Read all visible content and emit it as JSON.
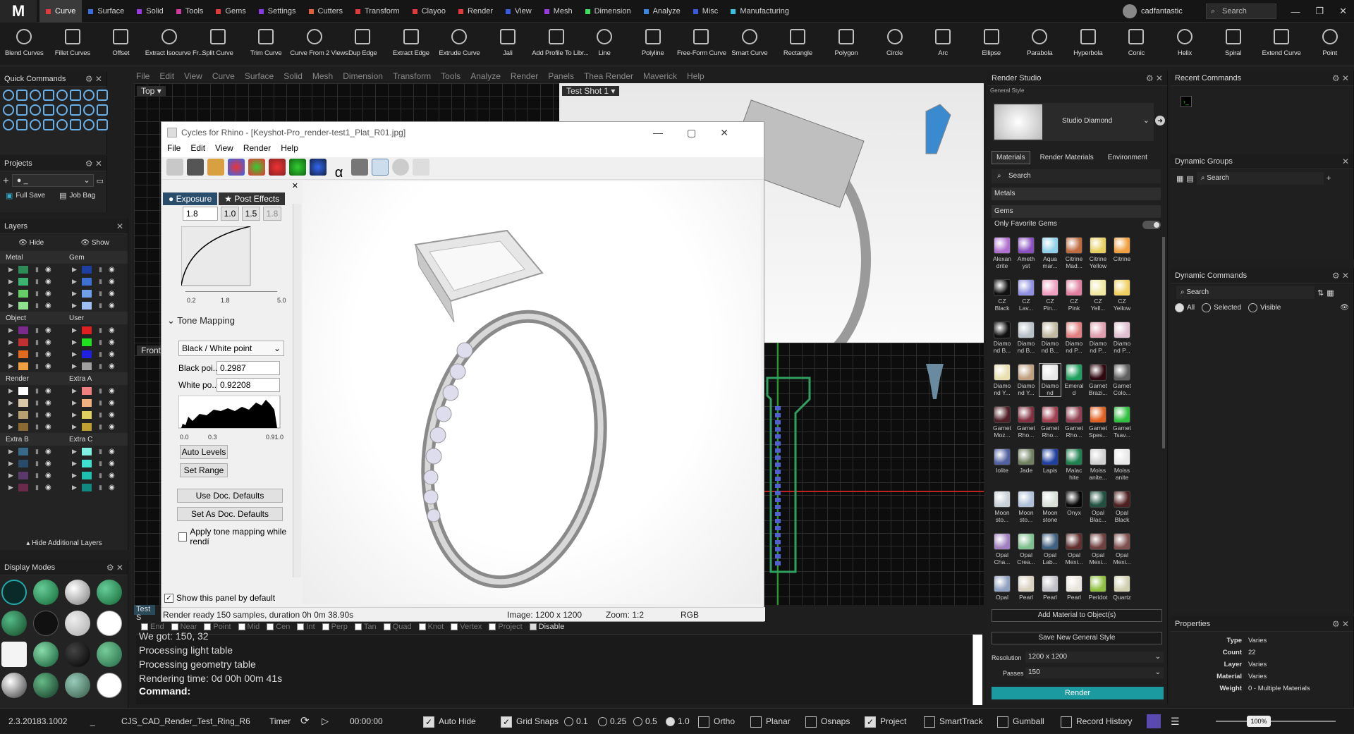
{
  "app": {
    "logo": "M",
    "user": "cadfantastic",
    "search": "Search"
  },
  "tabs": [
    {
      "label": "Curve",
      "color": "#e03a3a"
    },
    {
      "label": "Surface",
      "color": "#3a6ee0"
    },
    {
      "label": "Solid",
      "color": "#9a3ae0"
    },
    {
      "label": "Tools",
      "color": "#d03aa0"
    },
    {
      "label": "Gems",
      "color": "#e03a3a"
    },
    {
      "label": "Settings",
      "color": "#8a3ae0"
    },
    {
      "label": "Cutters",
      "color": "#e0603a"
    },
    {
      "label": "Transform",
      "color": "#e03a3a"
    },
    {
      "label": "Clayoo",
      "color": "#e03a3a"
    },
    {
      "label": "Render",
      "color": "#e03a3a"
    },
    {
      "label": "View",
      "color": "#3a5ae0"
    },
    {
      "label": "Mesh",
      "color": "#9a3ae0"
    },
    {
      "label": "Dimension",
      "color": "#3ae05a"
    },
    {
      "label": "Analyze",
      "color": "#3a8ae0"
    },
    {
      "label": "Misc",
      "color": "#3a5ae0"
    },
    {
      "label": "Manufacturing",
      "color": "#3ac0e0"
    }
  ],
  "tools": [
    "Blend Curves",
    "Fillet Curves",
    "Offset",
    "Extract Isocurve Fr...",
    "Split Curve",
    "Trim Curve",
    "Curve From 2 Views",
    "Dup Edge",
    "Extract Edge",
    "Extrude Curve",
    "Jali",
    "Add Profile To Libr...",
    "Line",
    "Polyline",
    "Free-Form Curve",
    "Smart Curve",
    "Rectangle",
    "Polygon",
    "Circle",
    "Arc",
    "Ellipse",
    "Parabola",
    "Hyperbola",
    "Conic",
    "Helix",
    "Spiral",
    "Extend Curve",
    "Point"
  ],
  "quick_commands": {
    "title": "Quick Commands"
  },
  "projects": {
    "title": "Projects",
    "dropdown": "_",
    "full_save": "Full Save",
    "job_bag": "Job Bag"
  },
  "layers": {
    "title": "Layers",
    "hide": "Hide",
    "show": "Show",
    "hide_additional": "Hide Additional Layers",
    "groups": [
      {
        "left": "Metal",
        "right": "Gem",
        "lcolors": [
          "#2e8b57",
          "#3cb371",
          "#66cd66",
          "#8fe08f"
        ],
        "rcolors": [
          "#1e3fa0",
          "#3f6fd0",
          "#6f9fe8",
          "#9fc0f0"
        ]
      },
      {
        "left": "Object",
        "right": "User",
        "lcolors": [
          "#7a2a8a",
          "#c03030",
          "#e06a20",
          "#f0a040"
        ],
        "rcolors": [
          "#e02020",
          "#20e020",
          "#2020e0",
          "#a0a0a0"
        ]
      },
      {
        "left": "Render",
        "right": "Extra A",
        "lcolors": [
          "#ffffff",
          "#d8c8a8",
          "#b8a070",
          "#8a6a30"
        ],
        "rcolors": [
          "#f08080",
          "#f0b080",
          "#e0d060",
          "#c0a030"
        ]
      },
      {
        "left": "Extra B",
        "right": "Extra C",
        "lcolors": [
          "#3a6a8a",
          "#2a4a6a",
          "#5a3a6a",
          "#6a2a4a"
        ],
        "rcolors": [
          "#80f0e0",
          "#40e0d0",
          "#20c0b0",
          "#108a80"
        ]
      }
    ]
  },
  "display_modes": {
    "title": "Display Modes"
  },
  "main_menu": [
    "File",
    "Edit",
    "View",
    "Curve",
    "Surface",
    "Solid",
    "Mesh",
    "Dimension",
    "Transform",
    "Tools",
    "Analyze",
    "Render",
    "Panels",
    "Thea Render",
    "Maverick",
    "Help"
  ],
  "viewports": {
    "top": "Top",
    "front": "Front",
    "test_shot": "Test Shot 1",
    "test_s": "Test S"
  },
  "cycles": {
    "title": "Cycles for Rhino - [Keyshot-Pro_render-test1_Plat_R01.jpg]",
    "menu": [
      "File",
      "Edit",
      "View",
      "Render",
      "Help"
    ],
    "tabs": {
      "exposure": "Exposure",
      "post_effects": "Post Effects"
    },
    "gamma": {
      "value": "1.8",
      "b1": "1.0",
      "b2": "1.5",
      "b3": "1.8",
      "min": "0.2",
      "mid": "1.8",
      "max": "5.0"
    },
    "tone": {
      "header": "Tone Mapping",
      "mode": "Black / White point",
      "black_label": "Black poi...",
      "black_value": "0.2987",
      "white_label": "White po...",
      "white_value": "0.92208",
      "hmin": "0.0",
      "hmid": "0.3",
      "hmax": "0.91.0"
    },
    "buttons": {
      "auto_levels": "Auto Levels",
      "set_range": "Set Range",
      "use_doc": "Use Doc. Defaults",
      "set_doc": "Set As Doc. Defaults"
    },
    "apply_tone": "Apply tone mapping while rendí",
    "show_panel": "Show this panel by default",
    "status": {
      "msg": "Render ready 150 samples, duration 0h 0m 38.90s",
      "image": "Image: 1200 x 1200",
      "zoom": "Zoom: 1:2",
      "mode": "RGB"
    }
  },
  "osnaps": [
    "End",
    "Near",
    "Point",
    "Mid",
    "Cen",
    "Int",
    "Perp",
    "Tan",
    "Quad",
    "Knot",
    "Vertex",
    "Project",
    "Disable"
  ],
  "console": {
    "lines": [
      "We got: 150, 32",
      "Processing light table",
      "Processing geometry table",
      "Rendering time: 0d 00h 00m 41s"
    ],
    "prompt": "Command:"
  },
  "render_studio": {
    "title": "Render Studio",
    "general_style": "General Style",
    "style_name": "Studio Diamond",
    "tabs": [
      "Materials",
      "Render Materials",
      "Environment"
    ],
    "search": "Search",
    "metals": "Metals",
    "gems": "Gems",
    "only_fav": "Only Favorite Gems",
    "gem_items": [
      {
        "n": "Alexan drite",
        "c": "#b070d0"
      },
      {
        "n": "Ameth yst",
        "c": "#8a50c0"
      },
      {
        "n": "Aqua mar...",
        "c": "#90d0e8"
      },
      {
        "n": "Citrine Mad...",
        "c": "#c06a40"
      },
      {
        "n": "Citrine Yellow",
        "c": "#e8d060"
      },
      {
        "n": "Citrine",
        "c": "#f0a040"
      },
      {
        "n": "CZ Black",
        "c": "#101010"
      },
      {
        "n": "CZ Lav...",
        "c": "#9090e0"
      },
      {
        "n": "CZ Pin...",
        "c": "#f0a0c0"
      },
      {
        "n": "CZ Pink",
        "c": "#e080a0"
      },
      {
        "n": "CZ Yell...",
        "c": "#f0e8a0"
      },
      {
        "n": "CZ Yellow",
        "c": "#f0d060"
      },
      {
        "n": "Diamo nd B...",
        "c": "#101010"
      },
      {
        "n": "Diamo nd B...",
        "c": "#b8c0c8"
      },
      {
        "n": "Diamo nd B...",
        "c": "#c0b8a0"
      },
      {
        "n": "Diamo nd P...",
        "c": "#e08080"
      },
      {
        "n": "Diamo nd P...",
        "c": "#e0a0b0"
      },
      {
        "n": "Diamo nd P...",
        "c": "#e0c0d0"
      },
      {
        "n": "Diamo nd Y...",
        "c": "#e8e0b0"
      },
      {
        "n": "Diamo nd Y...",
        "c": "#c0a080"
      },
      {
        "n": "Diamo nd",
        "c": "#e8e8e8"
      },
      {
        "n": "Emeral d",
        "c": "#20a060"
      },
      {
        "n": "Garnet Brazi...",
        "c": "#300810"
      },
      {
        "n": "Garnet Colo...",
        "c": "#606060"
      },
      {
        "n": "Garnet Moz...",
        "c": "#502028"
      },
      {
        "n": "Garnet Rho...",
        "c": "#803040"
      },
      {
        "n": "Garnet Rho...",
        "c": "#a04050"
      },
      {
        "n": "Garnet Rho...",
        "c": "#904050"
      },
      {
        "n": "Garnet Spes...",
        "c": "#e06020"
      },
      {
        "n": "Garnet Tsav...",
        "c": "#30c040"
      },
      {
        "n": "Iolite",
        "c": "#5060a0"
      },
      {
        "n": "Jade",
        "c": "#708060"
      },
      {
        "n": "Lapis",
        "c": "#2040a0"
      },
      {
        "n": "Malac hite",
        "c": "#208050"
      },
      {
        "n": "Moiss anite...",
        "c": "#d0d0d0"
      },
      {
        "n": "Moiss anite",
        "c": "#e8e8e8"
      },
      {
        "n": "Moon sto...",
        "c": "#c8d0d8"
      },
      {
        "n": "Moon sto...",
        "c": "#b0c0d8"
      },
      {
        "n": "Moon stone",
        "c": "#d8e0d8"
      },
      {
        "n": "Onyx",
        "c": "#080808"
      },
      {
        "n": "Opal Blac...",
        "c": "#205040"
      },
      {
        "n": "Opal Black",
        "c": "#502020"
      },
      {
        "n": "Opal Cha...",
        "c": "#a080c0"
      },
      {
        "n": "Opal Crea...",
        "c": "#80c090"
      },
      {
        "n": "Opal Lab...",
        "c": "#406080"
      },
      {
        "n": "Opal Mexi...",
        "c": "#603030"
      },
      {
        "n": "Opal Mexi...",
        "c": "#704040"
      },
      {
        "n": "Opal Mexi...",
        "c": "#805050"
      },
      {
        "n": "Opal",
        "c": "#90a0c0"
      },
      {
        "n": "Pearl",
        "c": "#d8d0c0"
      },
      {
        "n": "Pearl",
        "c": "#c0c0c8"
      },
      {
        "n": "Pearl",
        "c": "#e8e4dc"
      },
      {
        "n": "Peridot",
        "c": "#90c040"
      },
      {
        "n": "Quartz",
        "c": "#d0d0b0"
      }
    ],
    "add_material": "Add Material to Object(s)",
    "save_style": "Save New General Style",
    "resolution_label": "Resolution",
    "resolution": "1200 x 1200",
    "passes_label": "Passes",
    "passes": "150",
    "render": "Render"
  },
  "recent_commands": {
    "title": "Recent Commands"
  },
  "dynamic_groups": {
    "title": "Dynamic Groups",
    "search": "Search"
  },
  "dynamic_commands": {
    "title": "Dynamic Commands",
    "search": "Search",
    "all": "All",
    "selected": "Selected",
    "visible": "Visible"
  },
  "properties": {
    "title": "Properties",
    "rows": [
      [
        "Type",
        "Varies"
      ],
      [
        "Count",
        "22"
      ],
      [
        "Layer",
        "Varies"
      ],
      [
        "Material",
        "Varies"
      ],
      [
        "Weight",
        "0 - Multiple Materials"
      ]
    ]
  },
  "status": {
    "version": "2.3.20183.1002",
    "sep": "_",
    "file": "CJS_CAD_Render_Test_Ring_R6",
    "timer": "Timer",
    "time": "00:00:00",
    "auto_hide": "Auto Hide",
    "grid_snaps": "Grid Snaps",
    "r1": "0.1",
    "r2": "0.25",
    "r3": "0.5",
    "r4": "1.0",
    "ortho": "Ortho",
    "planar": "Planar",
    "osnaps": "Osnaps",
    "project": "Project",
    "smarttrack": "SmartTrack",
    "gumball": "Gumball",
    "record_history": "Record History",
    "zoom": "100%"
  }
}
